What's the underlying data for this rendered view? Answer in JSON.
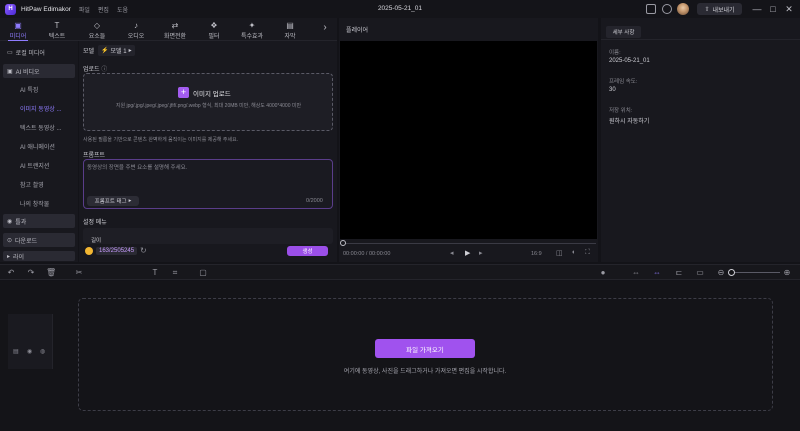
{
  "app": {
    "name": "HitPaw Edimakor",
    "project_title": "2025-05-21_01"
  },
  "menu": [
    "파일",
    "편집",
    "도움"
  ],
  "titlebar": {
    "export_label": "내보내기"
  },
  "toolbar": [
    {
      "icon": "media-icon",
      "label": "미디어",
      "active": true
    },
    {
      "icon": "text-icon",
      "label": "텍스트"
    },
    {
      "icon": "elements-icon",
      "label": "요소들"
    },
    {
      "icon": "audio-icon",
      "label": "오디오"
    },
    {
      "icon": "transition-icon",
      "label": "화면전환"
    },
    {
      "icon": "filter-icon",
      "label": "필터"
    },
    {
      "icon": "effects-icon",
      "label": "특수효과"
    },
    {
      "icon": "subtitle-icon",
      "label": "자막"
    }
  ],
  "leftnav": {
    "local_media": "로컬 미디어",
    "ai_video": "AI 비디오",
    "subs": [
      "AI 특징",
      "이미지 동영상 ...",
      "텍스트 동영상 ...",
      "AI 애니메이션",
      "AI 트랜지션",
      "참고 촬영",
      "나의 창작물"
    ],
    "template": "틀과",
    "download": "다운로드",
    "library": "라이"
  },
  "center": {
    "model_label": "모델",
    "model_value": "모델 1",
    "upload_label": "업로드",
    "upload_button": "이미지 업로드",
    "upload_hint": "지원 jpg/.jpg/.jpeg/.jpeg/.jfif/.png/.webp 형식, 최대 20MB 미만, 해상도 4000*4000 미만",
    "tip": "사용된 필름을 기반으로 콘텐츠 완벽하게 움직이는 이미지를 제공해 주세요.",
    "prompt_label": "프롬프트",
    "prompt_placeholder": "동영상의 장면을 주변 요소를 설명해 주세요.",
    "prompt_tag": "프롬프트 태그",
    "char_count": "0/2000",
    "settings_label": "설정 메뉴",
    "duration_label": "길이",
    "credits": "163/2505245",
    "generate_button": "생성"
  },
  "player": {
    "title": "플레이어",
    "time": "00:00:00 / 00:00:00",
    "ratio": "16:9"
  },
  "props": {
    "tab": "세부 사항",
    "fields": [
      {
        "label": "이름:",
        "value": "2025-05-21_01"
      },
      {
        "label": "프레임 속도:",
        "value": "30"
      },
      {
        "label": "저장 위치:",
        "value": "원하시 자동하기"
      }
    ]
  },
  "timeline": {
    "import_button": "파일 가져오기",
    "hint": "여기에 동영상, 사진을 드래그하거나 가져오면 편집을 시작합니다."
  }
}
